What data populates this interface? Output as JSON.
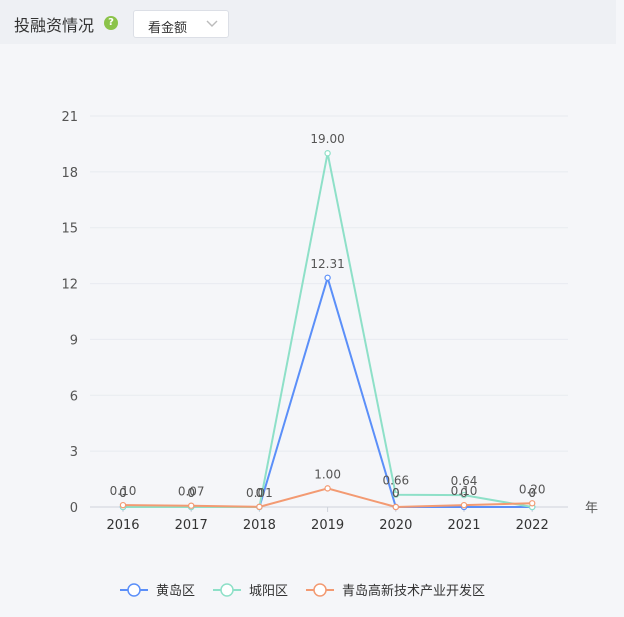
{
  "header": {
    "title": "投融资情况",
    "help_icon": "question-circle-icon",
    "dropdown": {
      "selected": "看金额"
    }
  },
  "colors": {
    "series": [
      "#5b8ff9",
      "#8ee0c8",
      "#f39a72"
    ],
    "axis": "#666666",
    "grid": "#e8ebf0"
  },
  "chart_data": {
    "type": "line",
    "x": [
      "2016",
      "2017",
      "2018",
      "2019",
      "2020",
      "2021",
      "2022"
    ],
    "xunit": "年",
    "ylim": [
      0,
      21
    ],
    "yticks": [
      0,
      3,
      6,
      9,
      12,
      15,
      18,
      21
    ],
    "grid": true,
    "legend_position": "bottom",
    "series": [
      {
        "name": "黄岛区",
        "values": [
          0,
          0,
          0,
          12.31,
          0,
          0,
          0
        ],
        "labels": [
          "0",
          "0",
          "0",
          "12.31",
          "0",
          "0",
          "0"
        ]
      },
      {
        "name": "城阳区",
        "values": [
          0,
          0,
          0,
          19.0,
          0.66,
          0.64,
          0
        ],
        "labels": [
          "0",
          "0",
          "0",
          "19.00",
          "0.66",
          "0.64",
          "0"
        ]
      },
      {
        "name": "青岛高新技术产业开发区",
        "values": [
          0.1,
          0.07,
          0.01,
          1.0,
          0,
          0.1,
          0.2
        ],
        "labels": [
          "0.10",
          "0.07",
          "0.01",
          "1.00",
          "0",
          "0.10",
          "0.20"
        ]
      }
    ]
  }
}
